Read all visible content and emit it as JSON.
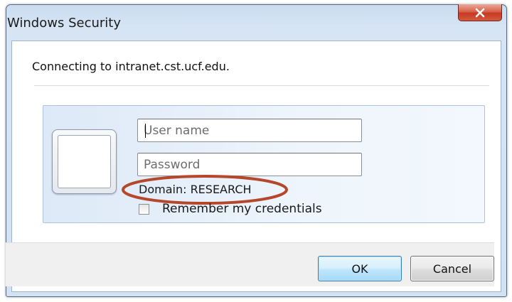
{
  "window": {
    "title": "Windows Security",
    "close_icon": "close-x-icon"
  },
  "message": {
    "connecting_text": "Connecting to intranet.cst.ucf.edu."
  },
  "credentials": {
    "user_icon": "user-tile-icon",
    "username": {
      "value": "",
      "placeholder": "User name"
    },
    "password": {
      "value": "",
      "placeholder": "Password"
    },
    "domain_text": "Domain: RESEARCH",
    "remember": {
      "label": "Remember my credentials",
      "checked": false
    }
  },
  "buttons": {
    "ok_label": "OK",
    "cancel_label": "Cancel"
  },
  "colors": {
    "highlight_ellipse": "#b5472b",
    "close_button": "#c9442a",
    "ok_border": "#3c7fb1"
  }
}
